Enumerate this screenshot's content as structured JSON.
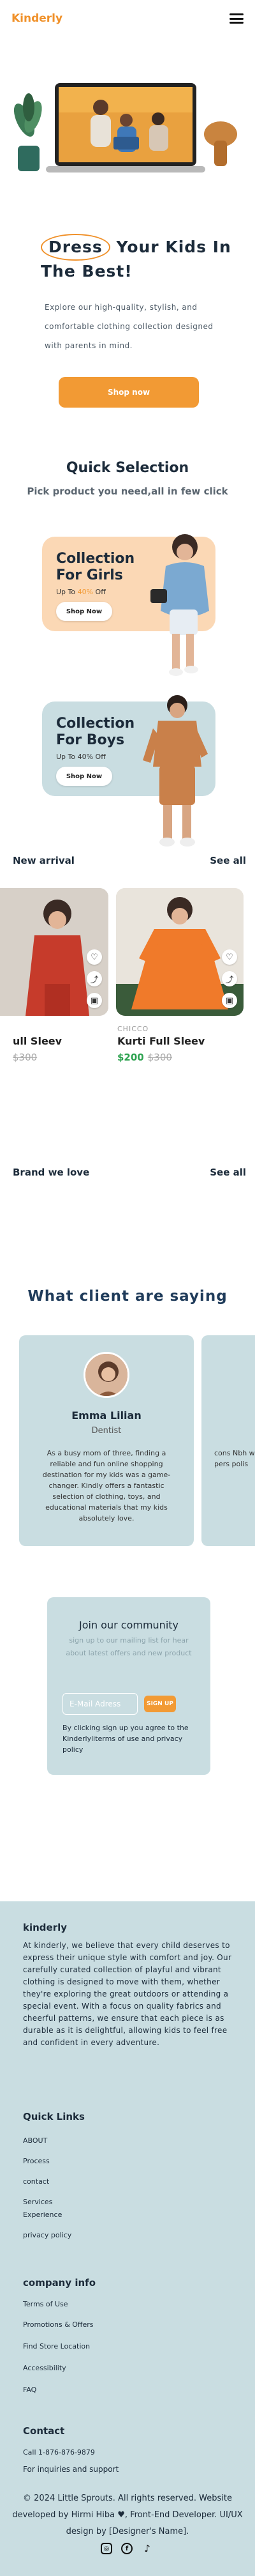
{
  "header": {
    "logo": "Kinderly",
    "menu_icon": "hamburger-menu-icon"
  },
  "hero": {
    "title_highlight": "Dress",
    "title_rest_1": " Your Kids In",
    "title_rest_2": "The Best!",
    "description": "Explore our high-quality, stylish, and comfortable clothing collection designed with parents in mind.",
    "cta": "Shop now"
  },
  "quick_selection": {
    "title": "Quick Selection",
    "subtitle": "Pick product you need,all in few click",
    "girls": {
      "title": "Collection For Girls",
      "off_prefix": "Up To ",
      "off_value": "40%",
      "off_suffix": " Off",
      "button": "Shop Now"
    },
    "boys": {
      "title": "Collection For Boys",
      "off_text": "Up To 40% Off",
      "button": "Shop Now"
    }
  },
  "new_arrival": {
    "title": "New arrival",
    "see_all": "See all",
    "products": [
      {
        "brand": "",
        "name": "ull Sleev",
        "price": "",
        "old_price": "$300"
      },
      {
        "brand": "CHICCO",
        "name": "Kurti Full Sleev",
        "price": "$200",
        "old_price": "$300"
      }
    ]
  },
  "brand_row": {
    "title": "Brand we love",
    "see_all": "See all"
  },
  "testimonials": {
    "title": "What client are saying",
    "items": [
      {
        "name": "Emma Lilian",
        "role": "Dentist",
        "quote": "As a busy mom of three, finding a reliable and fun online shopping destination for my kids was a game-changer. Kindly offers a fantastic selection of clothing, toys, and educational materials that my kids absolutely love."
      }
    ],
    "next_peek": "cons Nbh wea pers polis"
  },
  "newsletter": {
    "title": "Join our community",
    "description": "sign up to our mailing list for hear about latest offers and new product",
    "email_placeholder": "E-Mail Adress",
    "button": "SIGN UP",
    "note": "By clicking sign up you agree to the Kinderlyliterms of use and privacy policy"
  },
  "footer": {
    "brand_title": "kinderly",
    "about": "At kinderly, we believe that every child deserves to express their unique style with comfort and joy. Our carefully curated collection of playful and vibrant clothing is designed to move with them, whether they're exploring the great outdoors or attending a special event. With a focus on quality fabrics and cheerful patterns, we ensure that each piece is as durable as it is delightful, allowing kids to feel free and confident in every adventure.",
    "quick_links_title": "Quick Links",
    "quick_links": [
      "ABOUT",
      "Process",
      "contact",
      "Services",
      "Experience",
      "privacy policy"
    ],
    "company_title": "company info",
    "company_links": [
      "Terms of Use",
      "Promotions & Offers",
      "Find Store Location",
      "Accessibility",
      "FAQ"
    ],
    "contact_title": "Contact",
    "phone": "Call 1-876-876-9879",
    "contact_note": "For inquiries and support",
    "copyright": "© 2024 Little Sprouts. All rights reserved. Website developed by Hirmi Hiba ♥, Front-End Developer. UI/UX design by [Designer's Name].",
    "socials": [
      "instagram-icon",
      "facebook-icon",
      "tiktok-icon"
    ]
  },
  "colors": {
    "accent": "#f29a34",
    "panel": "#c9dde1",
    "peach": "#fbd8b5",
    "text": "#1c2b3a"
  }
}
